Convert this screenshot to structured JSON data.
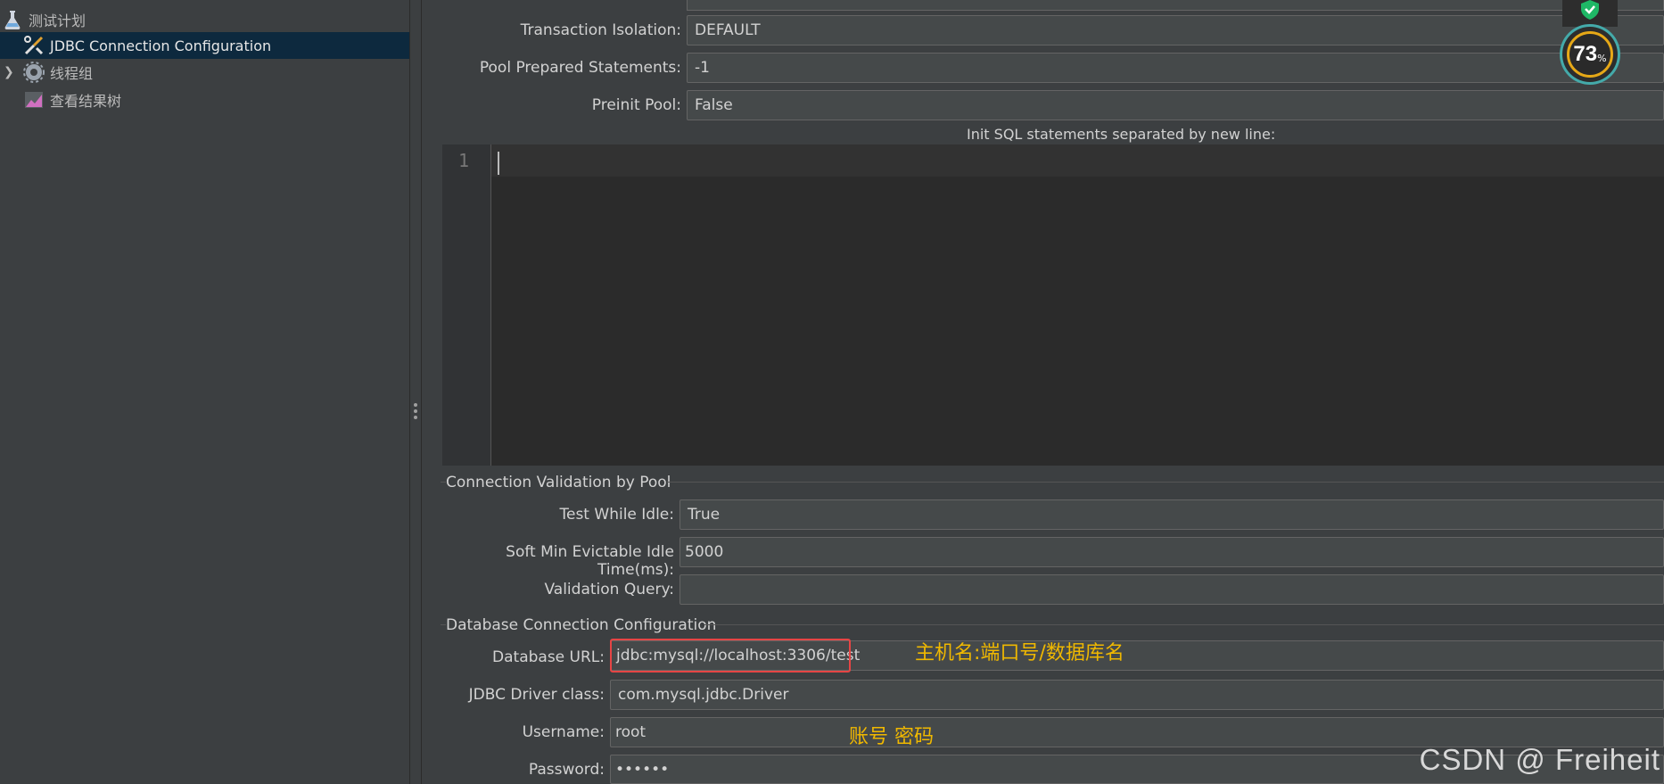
{
  "tree": {
    "items": [
      {
        "label": "测试计划",
        "icon": "flask-icon"
      },
      {
        "label": "JDBC Connection Configuration",
        "icon": "tools-icon"
      },
      {
        "label": "线程组",
        "icon": "gear-icon"
      },
      {
        "label": "查看结果树",
        "icon": "chart-icon"
      }
    ]
  },
  "pool": {
    "transaction_isolation_label": "Transaction Isolation:",
    "transaction_isolation_value": "DEFAULT",
    "pool_prepared_label": "Pool Prepared Statements:",
    "pool_prepared_value": "-1",
    "preinit_label": "Preinit Pool:",
    "preinit_value": "False",
    "init_sql_label": "Init SQL statements separated by new line:",
    "line_number": "1"
  },
  "validation": {
    "title": "Connection Validation by Pool",
    "test_idle_label": "Test While Idle:",
    "test_idle_value": "True",
    "soft_min_label": "Soft Min Evictable Idle Time(ms):",
    "soft_min_value": "5000",
    "query_label": "Validation Query:",
    "query_value": ""
  },
  "database": {
    "title": "Database Connection Configuration",
    "url_label": "Database URL:",
    "url_value": "jdbc:mysql://localhost:3306/test",
    "driver_label": "JDBC Driver class:",
    "driver_value": "com.mysql.jdbc.Driver",
    "username_label": "Username:",
    "username_value": "root",
    "password_label": "Password:",
    "password_value": "••••••"
  },
  "annotations": {
    "url_note": "主机名:端口号/数据库名",
    "account_note": "账号 密码"
  },
  "widget": {
    "percent": "73",
    "unit": "%"
  },
  "watermark": "CSDN @ Freiheit",
  "colors": {
    "background": "#3c3f41",
    "selected": "#0d293e",
    "highlight": "#e64545",
    "note": "#f0b800"
  }
}
